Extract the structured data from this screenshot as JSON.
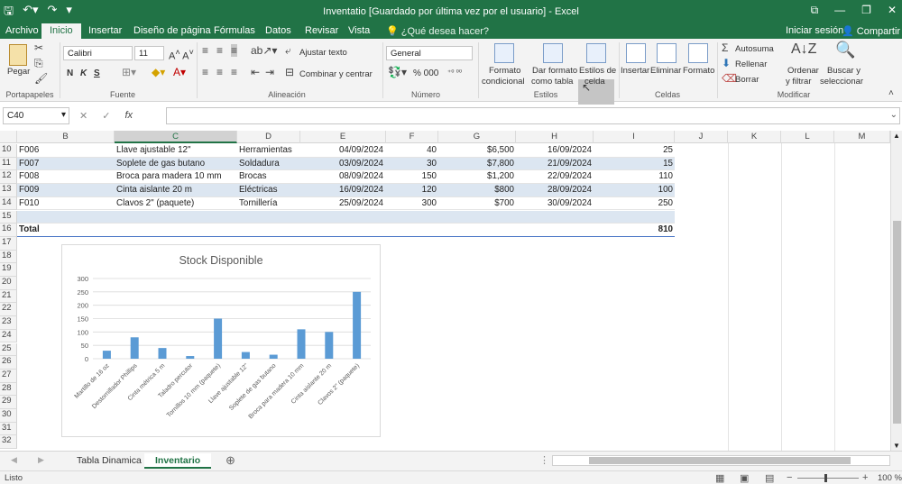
{
  "window": {
    "title": "Inventatio [Guardado por última vez por el usuario] - Excel",
    "controls": [
      "⧉",
      "—",
      "❐",
      "✕"
    ]
  },
  "tabs": {
    "items": [
      "Archivo",
      "Inicio",
      "Insertar",
      "Diseño de página",
      "Fórmulas",
      "Datos",
      "Revisar",
      "Vista"
    ],
    "active": "Inicio",
    "tell_me": "¿Qué desea hacer?",
    "sign_in": "Iniciar sesión",
    "share": "Compartir"
  },
  "ribbon": {
    "groups": [
      "Portapapeles",
      "Fuente",
      "Alineación",
      "Número",
      "Estilos",
      "Celdas",
      "Modificar"
    ],
    "paste": "Pegar",
    "font_name": "Calibri",
    "font_size": "11",
    "bold": "N",
    "italic": "K",
    "underline": "S",
    "wrap_text": "Ajustar texto",
    "merge_center": "Combinar y centrar",
    "number_format": "General",
    "conditional_format": [
      "Formato",
      "condicional"
    ],
    "format_as_table": [
      "Dar formato",
      "como tabla"
    ],
    "cell_styles": [
      "Estilos de",
      "celda"
    ],
    "insert": "Insertar",
    "delete": "Eliminar",
    "format": "Formato",
    "autosum": "Autosuma",
    "fill": "Rellenar",
    "clear": "Borrar",
    "sort_filter": [
      "Ordenar",
      "y filtrar"
    ],
    "find_select": [
      "Buscar y",
      "seleccionar"
    ]
  },
  "formula_bar": {
    "name_box": "C40",
    "fx": "fx",
    "formula": ""
  },
  "columns": [
    "B",
    "C",
    "D",
    "E",
    "F",
    "G",
    "H",
    "I",
    "J",
    "K",
    "L",
    "M"
  ],
  "selected_column": "C",
  "rows": [
    {
      "num": "10",
      "id": "F006",
      "name": "Llave ajustable 12\"",
      "cat": "Herramientas",
      "date": "04/09/2024",
      "qty": "40",
      "price": "$6,500",
      "date2": "16/09/2024",
      "stock": "25",
      "band": false
    },
    {
      "num": "11",
      "id": "F007",
      "name": "Soplete de gas butano",
      "cat": "Soldadura",
      "date": "03/09/2024",
      "qty": "30",
      "price": "$7,800",
      "date2": "21/09/2024",
      "stock": "15",
      "band": true
    },
    {
      "num": "12",
      "id": "F008",
      "name": "Broca para madera 10 mm",
      "cat": "Brocas",
      "date": "08/09/2024",
      "qty": "150",
      "price": "$1,200",
      "date2": "22/09/2024",
      "stock": "110",
      "band": false
    },
    {
      "num": "13",
      "id": "F009",
      "name": "Cinta aislante 20 m",
      "cat": "Eléctricas",
      "date": "16/09/2024",
      "qty": "120",
      "price": "$800",
      "date2": "28/09/2024",
      "stock": "100",
      "band": true
    },
    {
      "num": "14",
      "id": "F010",
      "name": "Clavos 2\" (paquete)",
      "cat": "Tornillería",
      "date": "25/09/2024",
      "qty": "300",
      "price": "$700",
      "date2": "30/09/2024",
      "stock": "250",
      "band": false
    },
    {
      "num": "15",
      "id": "",
      "name": "",
      "cat": "",
      "date": "",
      "qty": "",
      "price": "",
      "date2": "",
      "stock": "",
      "band": true
    },
    {
      "num": "16",
      "id": "Total",
      "name": "",
      "cat": "",
      "date": "",
      "qty": "",
      "price": "",
      "date2": "",
      "stock": "810",
      "band": false
    }
  ],
  "empty_rows": [
    "17",
    "18",
    "19",
    "20",
    "21",
    "22",
    "23",
    "24",
    "25",
    "26",
    "27",
    "28",
    "29",
    "30",
    "31",
    "32"
  ],
  "chart_data": {
    "type": "bar",
    "title": "Stock Disponible",
    "categories": [
      "Martillo de 16 oz",
      "Destornillador Phillips",
      "Cinta métrica 5 m",
      "Taladro percutor",
      "Tornillos 10 mm (paquete)",
      "Llave ajustable 12\"",
      "Soplete de gas butano",
      "Broca para madera 10 mm",
      "Cinta aislante 20 m",
      "Clavos 2\" (paquete)"
    ],
    "values": [
      30,
      80,
      40,
      10,
      150,
      25,
      15,
      110,
      100,
      250
    ],
    "ylim": [
      0,
      300
    ],
    "yticks": [
      "300",
      "250",
      "200",
      "150",
      "100",
      "50",
      "0"
    ],
    "bar_color": "#5b9bd5",
    "grid": true
  },
  "sheets": {
    "items": [
      "Tabla Dinamica",
      "Inventario"
    ],
    "active": "Inventario"
  },
  "status": {
    "text": "Listo",
    "zoom": "100 %"
  },
  "colors": {
    "excel_green": "#217346",
    "band": "#dce6f1"
  }
}
